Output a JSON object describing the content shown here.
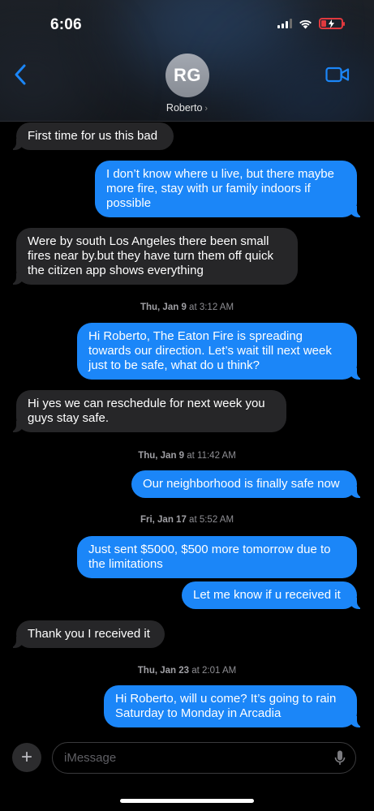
{
  "status_bar": {
    "time": "6:06"
  },
  "header": {
    "avatar_initials": "RG",
    "contact_name": "Roberto",
    "contact_chevron": "›"
  },
  "conversation": {
    "m1": "First time for us this bad",
    "m2": "I don’t know where u live, but there maybe more fire, stay with ur family indoors if possible",
    "m3": "Were by south Los Angeles there been small fires near by.but they have turn them off quick the citizen app shows everything",
    "ts1_day": "Thu, Jan 9",
    "ts1_time": "at 3:12 AM",
    "m4": "Hi Roberto, The Eaton Fire is spreading towards our direction. Let’s wait till next week just to be safe, what do u think?",
    "m5": "Hi yes we can reschedule for next week you guys stay safe.",
    "ts2_day": "Thu, Jan 9",
    "ts2_time": "at 11:42 AM",
    "m6": "Our neighborhood is finally safe now",
    "ts3_day": "Fri, Jan 17",
    "ts3_time": "at 5:52 AM",
    "m7": "Just sent $5000, $500 more tomorrow due to the limitations",
    "m8": "Let me know if u received it",
    "m9": "Thank you I received it",
    "ts4_day": "Thu, Jan 23",
    "ts4_time": "at 2:01 AM",
    "m10": "Hi Roberto, will u come? It’s going to rain Saturday to Monday in Arcadia"
  },
  "composer": {
    "plus_label": "+",
    "placeholder": "iMessage"
  },
  "colors": {
    "outgoing": "#1b86f8",
    "incoming": "#262628",
    "accent": "#1b86f8",
    "battery": "#e0393e"
  },
  "icons": [
    "back-chevron-icon",
    "video-camera-icon",
    "signal-icon",
    "wifi-icon",
    "battery-charging-icon",
    "plus-icon",
    "microphone-icon"
  ]
}
